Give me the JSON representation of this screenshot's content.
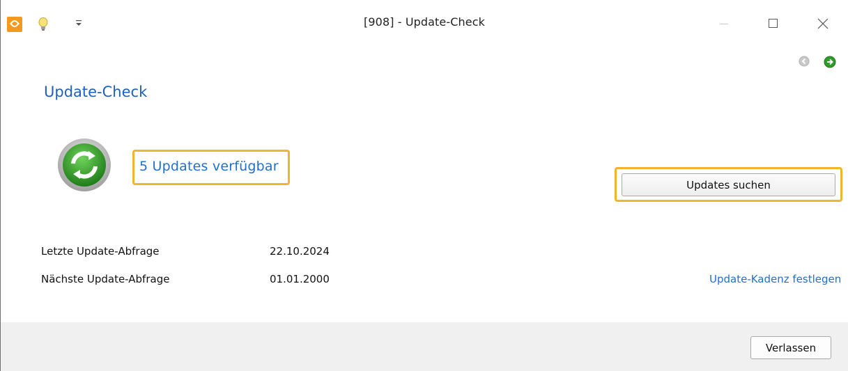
{
  "window": {
    "title": "[908] - Update-Check"
  },
  "icons": {
    "app": "app-logo-icon",
    "bulb": "lightbulb-icon",
    "quick_access": "customize-quick-access-icon",
    "back": "nav-back-icon",
    "forward": "nav-forward-icon",
    "update": "sync-arrows-icon"
  },
  "colors": {
    "heading_blue": "#1f5fbf",
    "link_blue": "#1f6fd0",
    "highlight": "#f0b52a",
    "sync_green": "#3aa52f"
  },
  "main": {
    "heading": "Update-Check",
    "updates_available": "5 Updates verfügbar",
    "search_button": "Updates suchen",
    "last_check_label": "Letzte Update-Abfrage",
    "last_check_value": "22.10.2024",
    "next_check_label": "Nächste Update-Abfrage",
    "next_check_value": "01.01.2000",
    "cadence_link": "Update-Kadenz festlegen"
  },
  "footer": {
    "leave_button": "Verlassen"
  }
}
